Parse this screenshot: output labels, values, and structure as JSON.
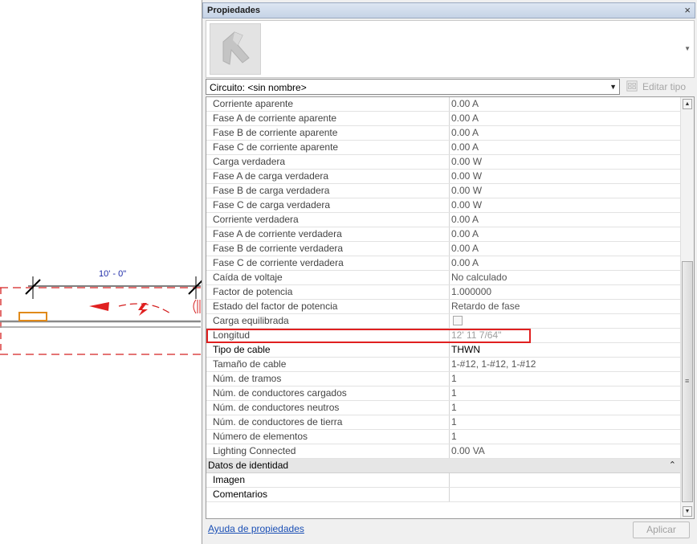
{
  "canvas": {
    "dimension_text": "10' - 0\""
  },
  "palette": {
    "title": "Propiedades",
    "close_glyph": "×",
    "type_icon": "cable-tray-family-icon",
    "selector": {
      "value": "Circuito: <sin nombre>",
      "arrow": "▼"
    },
    "edit_type_label": "Editar tipo",
    "rows": [
      {
        "name": "Corriente aparente",
        "value": "0.00 A"
      },
      {
        "name": "Fase A de corriente aparente",
        "value": "0.00 A"
      },
      {
        "name": "Fase B de corriente aparente",
        "value": "0.00 A"
      },
      {
        "name": "Fase C de corriente aparente",
        "value": "0.00 A"
      },
      {
        "name": "Carga verdadera",
        "value": "0.00 W"
      },
      {
        "name": "Fase A de carga verdadera",
        "value": "0.00 W"
      },
      {
        "name": "Fase B de carga verdadera",
        "value": "0.00 W"
      },
      {
        "name": "Fase C de carga verdadera",
        "value": "0.00 W"
      },
      {
        "name": "Corriente verdadera",
        "value": "0.00 A"
      },
      {
        "name": "Fase A de corriente verdadera",
        "value": "0.00 A"
      },
      {
        "name": "Fase B de corriente verdadera",
        "value": "0.00 A"
      },
      {
        "name": "Fase C de corriente verdadera",
        "value": "0.00 A"
      },
      {
        "name": "Caída de voltaje",
        "value": "No calculado"
      },
      {
        "name": "Factor de potencia",
        "value": "1.000000"
      },
      {
        "name": "Estado del factor de potencia",
        "value": "Retardo de fase"
      },
      {
        "name": "Carga equilibrada",
        "value": ""
      },
      {
        "name": "Longitud",
        "value": "12'  11 7/64\""
      },
      {
        "name": "Tipo de cable",
        "value": "THWN"
      },
      {
        "name": "Tamaño de cable",
        "value": "1-#12, 1-#12, 1-#12"
      },
      {
        "name": "Núm. de tramos",
        "value": "1"
      },
      {
        "name": "Núm. de conductores cargados",
        "value": "1"
      },
      {
        "name": "Núm. de conductores neutros",
        "value": "1"
      },
      {
        "name": "Núm. de conductores de tierra",
        "value": "1"
      },
      {
        "name": "Número de elementos",
        "value": "1"
      },
      {
        "name": "Lighting Connected",
        "value": "0.00 VA"
      }
    ],
    "group_identity": {
      "label": "Datos de identidad",
      "collapse_glyph": "⌃"
    },
    "identity_rows": [
      {
        "name": "Imagen",
        "value": ""
      },
      {
        "name": "Comentarios",
        "value": ""
      }
    ],
    "help_link": "Ayuda de propiedades",
    "apply_label": "Aplicar"
  },
  "colors": {
    "highlight": "#e02020",
    "wire_dash": "#d42020",
    "device_orange": "#e08a1a",
    "dimension_blue": "#1d2aa8"
  }
}
